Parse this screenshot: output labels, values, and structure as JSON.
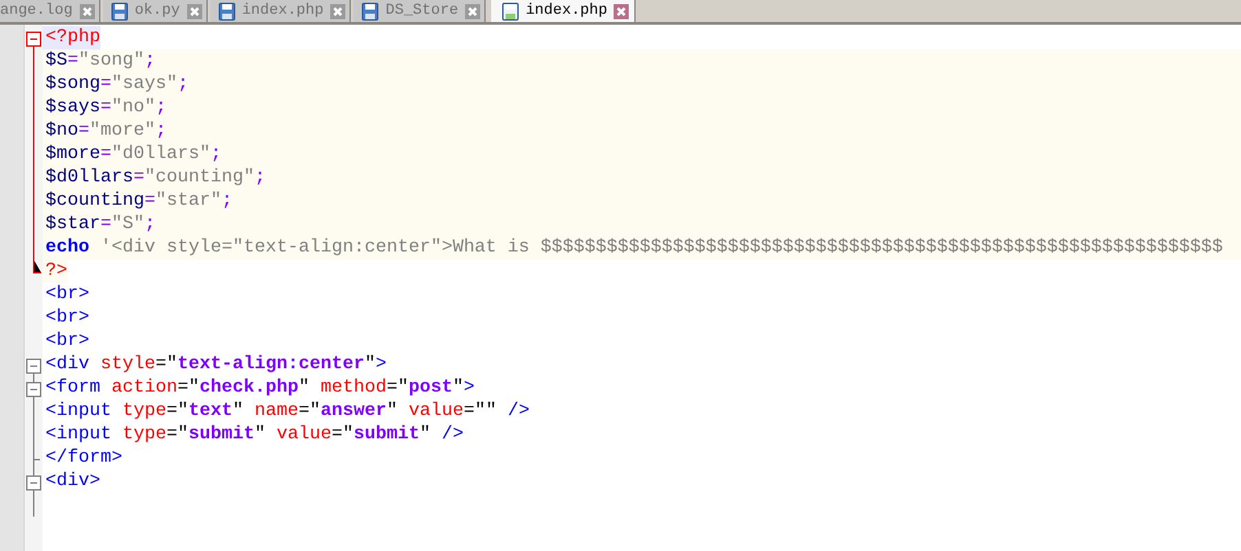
{
  "tabs": [
    {
      "label": "ange.log",
      "selected": false
    },
    {
      "label": "ok.py",
      "selected": false
    },
    {
      "label": "index.php",
      "selected": false
    },
    {
      "label": "DS_Store",
      "selected": false
    },
    {
      "label": "index.php",
      "selected": true
    }
  ],
  "lines": [
    {
      "kind": "start",
      "embedded": true,
      "current": true,
      "tokens": [
        {
          "kind": "php-tag",
          "text": "<?php"
        }
      ]
    },
    {
      "kind": "inner",
      "embedded": true,
      "current": false,
      "tokens": [
        {
          "kind": "variable",
          "text": "$S"
        },
        {
          "kind": "operator",
          "text": "="
        },
        {
          "kind": "string",
          "text": "\"song\""
        },
        {
          "kind": "operator",
          "text": ";"
        }
      ]
    },
    {
      "kind": "inner",
      "embedded": true,
      "current": false,
      "tokens": [
        {
          "kind": "variable",
          "text": "$song"
        },
        {
          "kind": "operator",
          "text": "="
        },
        {
          "kind": "string",
          "text": "\"says\""
        },
        {
          "kind": "operator",
          "text": ";"
        }
      ]
    },
    {
      "kind": "inner",
      "embedded": true,
      "current": false,
      "tokens": [
        {
          "kind": "variable",
          "text": "$says"
        },
        {
          "kind": "operator",
          "text": "="
        },
        {
          "kind": "string",
          "text": "\"no\""
        },
        {
          "kind": "operator",
          "text": ";"
        }
      ]
    },
    {
      "kind": "inner",
      "embedded": true,
      "current": false,
      "tokens": [
        {
          "kind": "variable",
          "text": "$no"
        },
        {
          "kind": "operator",
          "text": "="
        },
        {
          "kind": "string",
          "text": "\"more\""
        },
        {
          "kind": "operator",
          "text": ";"
        }
      ]
    },
    {
      "kind": "inner",
      "embedded": true,
      "current": false,
      "tokens": [
        {
          "kind": "variable",
          "text": "$more"
        },
        {
          "kind": "operator",
          "text": "="
        },
        {
          "kind": "string",
          "text": "\"d0llars\""
        },
        {
          "kind": "operator",
          "text": ";"
        }
      ]
    },
    {
      "kind": "inner",
      "embedded": true,
      "current": false,
      "tokens": [
        {
          "kind": "variable",
          "text": "$d0llars"
        },
        {
          "kind": "operator",
          "text": "="
        },
        {
          "kind": "string",
          "text": "\"counting\""
        },
        {
          "kind": "operator",
          "text": ";"
        }
      ]
    },
    {
      "kind": "inner",
      "embedded": true,
      "current": false,
      "tokens": [
        {
          "kind": "variable",
          "text": "$counting"
        },
        {
          "kind": "operator",
          "text": "="
        },
        {
          "kind": "string",
          "text": "\"star\""
        },
        {
          "kind": "operator",
          "text": ";"
        }
      ]
    },
    {
      "kind": "inner",
      "embedded": true,
      "current": false,
      "tokens": [
        {
          "kind": "variable",
          "text": "$star"
        },
        {
          "kind": "operator",
          "text": "="
        },
        {
          "kind": "string",
          "text": "\"S\""
        },
        {
          "kind": "operator",
          "text": ";"
        }
      ]
    },
    {
      "kind": "inner",
      "embedded": true,
      "current": false,
      "tokens": [
        {
          "kind": "keyword",
          "text": "echo"
        },
        {
          "kind": "string",
          "text": " '<div style=\"text-align:center\">What is $$$$$$$$$$$$$$$$$$$$$$$$$$$$$$$$$$$$$$$$$$$$$$$$$$$$$$$$$$$$$$"
        }
      ]
    },
    {
      "kind": "end",
      "embedded": true,
      "current": false,
      "tokens": [
        {
          "kind": "php-tag",
          "text": "?>"
        }
      ]
    },
    {
      "kind": "none",
      "embedded": false,
      "current": false,
      "tokens": [
        {
          "kind": "tag",
          "text": "<br>"
        }
      ]
    },
    {
      "kind": "none",
      "embedded": false,
      "current": false,
      "tokens": [
        {
          "kind": "tag",
          "text": "<br>"
        }
      ]
    },
    {
      "kind": "none",
      "embedded": false,
      "current": false,
      "tokens": [
        {
          "kind": "tag",
          "text": "<br>"
        }
      ]
    },
    {
      "kind": "start",
      "embedded": false,
      "current": false,
      "tokens": [
        {
          "kind": "tag",
          "text": "<div "
        },
        {
          "kind": "attribute",
          "text": "style"
        },
        {
          "kind": "plain",
          "text": "=\""
        },
        {
          "kind": "value",
          "text": "text-align:center"
        },
        {
          "kind": "plain",
          "text": "\""
        },
        {
          "kind": "tag",
          "text": ">"
        }
      ]
    },
    {
      "kind": "start-inner",
      "embedded": false,
      "current": false,
      "tokens": [
        {
          "kind": "tag",
          "text": "<form "
        },
        {
          "kind": "attribute",
          "text": "action"
        },
        {
          "kind": "plain",
          "text": "=\""
        },
        {
          "kind": "value",
          "text": "check.php"
        },
        {
          "kind": "plain",
          "text": "\" "
        },
        {
          "kind": "attribute",
          "text": "method"
        },
        {
          "kind": "plain",
          "text": "=\""
        },
        {
          "kind": "value",
          "text": "post"
        },
        {
          "kind": "plain",
          "text": "\""
        },
        {
          "kind": "tag",
          "text": ">"
        }
      ]
    },
    {
      "kind": "inner",
      "embedded": false,
      "current": false,
      "tokens": [
        {
          "kind": "tag",
          "text": "<input "
        },
        {
          "kind": "attribute",
          "text": "type"
        },
        {
          "kind": "plain",
          "text": "=\""
        },
        {
          "kind": "value",
          "text": "text"
        },
        {
          "kind": "plain",
          "text": "\" "
        },
        {
          "kind": "attribute",
          "text": "name"
        },
        {
          "kind": "plain",
          "text": "=\""
        },
        {
          "kind": "value",
          "text": "answer"
        },
        {
          "kind": "plain",
          "text": "\" "
        },
        {
          "kind": "attribute",
          "text": "value"
        },
        {
          "kind": "plain",
          "text": "=\"\" "
        },
        {
          "kind": "tag",
          "text": "/>"
        }
      ]
    },
    {
      "kind": "inner",
      "embedded": false,
      "current": false,
      "tokens": [
        {
          "kind": "tag",
          "text": "<input "
        },
        {
          "kind": "attribute",
          "text": "type"
        },
        {
          "kind": "plain",
          "text": "=\""
        },
        {
          "kind": "value",
          "text": "submit"
        },
        {
          "kind": "plain",
          "text": "\" "
        },
        {
          "kind": "attribute",
          "text": "value"
        },
        {
          "kind": "plain",
          "text": "=\""
        },
        {
          "kind": "value",
          "text": "submit"
        },
        {
          "kind": "plain",
          "text": "\" "
        },
        {
          "kind": "tag",
          "text": "/>"
        }
      ]
    },
    {
      "kind": "inner-end",
      "embedded": false,
      "current": false,
      "tokens": [
        {
          "kind": "tag",
          "text": "</form>"
        }
      ]
    },
    {
      "kind": "start-inner",
      "embedded": false,
      "current": false,
      "tokens": [
        {
          "kind": "tag",
          "text": "<div>"
        }
      ]
    },
    {
      "kind": "inner",
      "embedded": false,
      "current": false
    }
  ]
}
